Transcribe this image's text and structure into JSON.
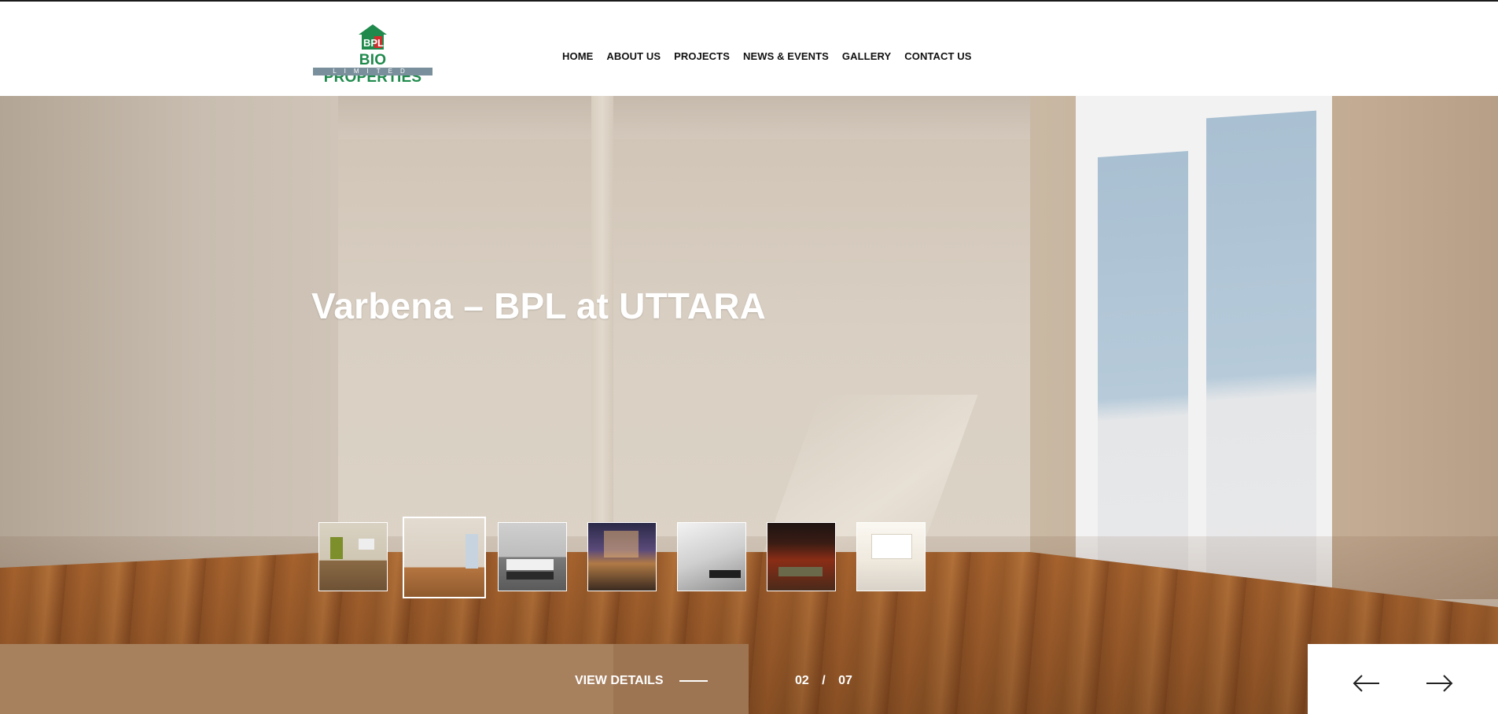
{
  "brand": {
    "logo_mark": "BPL",
    "name": "BIO PROPERTIES",
    "subtitle": "LIMITED",
    "colors": {
      "green": "#1f8a4c",
      "red": "#d22c2c"
    }
  },
  "nav": {
    "items": [
      {
        "label": "HOME"
      },
      {
        "label": "ABOUT US"
      },
      {
        "label": "PROJECTS"
      },
      {
        "label": "NEWS & EVENTS"
      },
      {
        "label": "GALLERY"
      },
      {
        "label": "CONTACT US"
      }
    ]
  },
  "hero": {
    "title": "Varbena – BPL at UTTARA",
    "cta_label": "VIEW DETAILS",
    "current_slide": "02",
    "separator": "/",
    "total_slides": "07",
    "active_thumb_index": 1,
    "thumbnail_icons": [
      "living-room-thumb",
      "empty-room-thumb",
      "tv-unit-thumb",
      "night-city-room-thumb",
      "staircase-thumb",
      "red-lounge-thumb",
      "bright-hall-thumb"
    ],
    "accent_color": "#a7805e",
    "prev_icon": "arrow-left-icon",
    "next_icon": "arrow-right-icon"
  }
}
